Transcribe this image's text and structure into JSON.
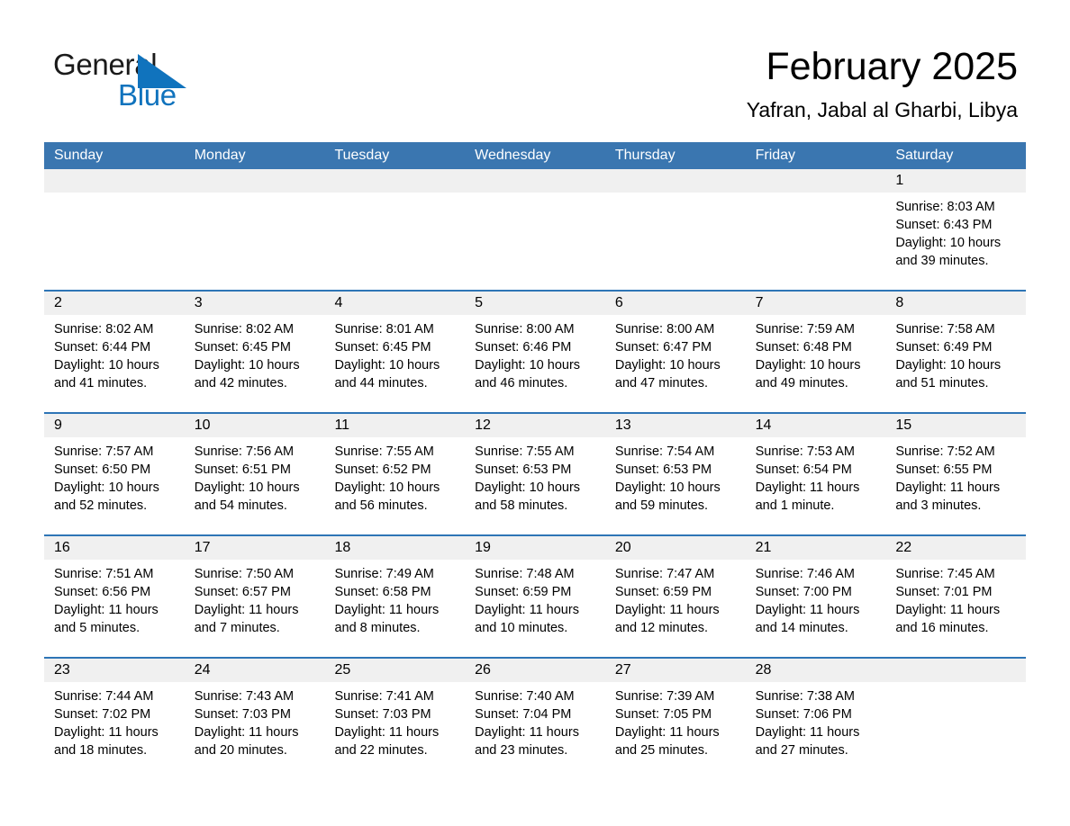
{
  "brand": {
    "name_line1": "General",
    "name_line2": "Blue",
    "accent_color": "#1073bd",
    "triangle_icon": "triangle-icon"
  },
  "header": {
    "title": "February 2025",
    "subtitle": "Yafran, Jabal al Gharbi, Libya"
  },
  "colors": {
    "header_blue": "#3a76b0",
    "row_rule_blue": "#2e75b6",
    "day_strip_gray": "#f0f0f0"
  },
  "weekdays": [
    "Sunday",
    "Monday",
    "Tuesday",
    "Wednesday",
    "Thursday",
    "Friday",
    "Saturday"
  ],
  "weeks": [
    [
      {
        "day": "",
        "empty": true
      },
      {
        "day": "",
        "empty": true
      },
      {
        "day": "",
        "empty": true
      },
      {
        "day": "",
        "empty": true
      },
      {
        "day": "",
        "empty": true
      },
      {
        "day": "",
        "empty": true
      },
      {
        "day": "1",
        "sunrise": "Sunrise: 8:03 AM",
        "sunset": "Sunset: 6:43 PM",
        "daylight_l1": "Daylight: 10 hours",
        "daylight_l2": "and 39 minutes."
      }
    ],
    [
      {
        "day": "2",
        "sunrise": "Sunrise: 8:02 AM",
        "sunset": "Sunset: 6:44 PM",
        "daylight_l1": "Daylight: 10 hours",
        "daylight_l2": "and 41 minutes."
      },
      {
        "day": "3",
        "sunrise": "Sunrise: 8:02 AM",
        "sunset": "Sunset: 6:45 PM",
        "daylight_l1": "Daylight: 10 hours",
        "daylight_l2": "and 42 minutes."
      },
      {
        "day": "4",
        "sunrise": "Sunrise: 8:01 AM",
        "sunset": "Sunset: 6:45 PM",
        "daylight_l1": "Daylight: 10 hours",
        "daylight_l2": "and 44 minutes."
      },
      {
        "day": "5",
        "sunrise": "Sunrise: 8:00 AM",
        "sunset": "Sunset: 6:46 PM",
        "daylight_l1": "Daylight: 10 hours",
        "daylight_l2": "and 46 minutes."
      },
      {
        "day": "6",
        "sunrise": "Sunrise: 8:00 AM",
        "sunset": "Sunset: 6:47 PM",
        "daylight_l1": "Daylight: 10 hours",
        "daylight_l2": "and 47 minutes."
      },
      {
        "day": "7",
        "sunrise": "Sunrise: 7:59 AM",
        "sunset": "Sunset: 6:48 PM",
        "daylight_l1": "Daylight: 10 hours",
        "daylight_l2": "and 49 minutes."
      },
      {
        "day": "8",
        "sunrise": "Sunrise: 7:58 AM",
        "sunset": "Sunset: 6:49 PM",
        "daylight_l1": "Daylight: 10 hours",
        "daylight_l2": "and 51 minutes."
      }
    ],
    [
      {
        "day": "9",
        "sunrise": "Sunrise: 7:57 AM",
        "sunset": "Sunset: 6:50 PM",
        "daylight_l1": "Daylight: 10 hours",
        "daylight_l2": "and 52 minutes."
      },
      {
        "day": "10",
        "sunrise": "Sunrise: 7:56 AM",
        "sunset": "Sunset: 6:51 PM",
        "daylight_l1": "Daylight: 10 hours",
        "daylight_l2": "and 54 minutes."
      },
      {
        "day": "11",
        "sunrise": "Sunrise: 7:55 AM",
        "sunset": "Sunset: 6:52 PM",
        "daylight_l1": "Daylight: 10 hours",
        "daylight_l2": "and 56 minutes."
      },
      {
        "day": "12",
        "sunrise": "Sunrise: 7:55 AM",
        "sunset": "Sunset: 6:53 PM",
        "daylight_l1": "Daylight: 10 hours",
        "daylight_l2": "and 58 minutes."
      },
      {
        "day": "13",
        "sunrise": "Sunrise: 7:54 AM",
        "sunset": "Sunset: 6:53 PM",
        "daylight_l1": "Daylight: 10 hours",
        "daylight_l2": "and 59 minutes."
      },
      {
        "day": "14",
        "sunrise": "Sunrise: 7:53 AM",
        "sunset": "Sunset: 6:54 PM",
        "daylight_l1": "Daylight: 11 hours",
        "daylight_l2": "and 1 minute."
      },
      {
        "day": "15",
        "sunrise": "Sunrise: 7:52 AM",
        "sunset": "Sunset: 6:55 PM",
        "daylight_l1": "Daylight: 11 hours",
        "daylight_l2": "and 3 minutes."
      }
    ],
    [
      {
        "day": "16",
        "sunrise": "Sunrise: 7:51 AM",
        "sunset": "Sunset: 6:56 PM",
        "daylight_l1": "Daylight: 11 hours",
        "daylight_l2": "and 5 minutes."
      },
      {
        "day": "17",
        "sunrise": "Sunrise: 7:50 AM",
        "sunset": "Sunset: 6:57 PM",
        "daylight_l1": "Daylight: 11 hours",
        "daylight_l2": "and 7 minutes."
      },
      {
        "day": "18",
        "sunrise": "Sunrise: 7:49 AM",
        "sunset": "Sunset: 6:58 PM",
        "daylight_l1": "Daylight: 11 hours",
        "daylight_l2": "and 8 minutes."
      },
      {
        "day": "19",
        "sunrise": "Sunrise: 7:48 AM",
        "sunset": "Sunset: 6:59 PM",
        "daylight_l1": "Daylight: 11 hours",
        "daylight_l2": "and 10 minutes."
      },
      {
        "day": "20",
        "sunrise": "Sunrise: 7:47 AM",
        "sunset": "Sunset: 6:59 PM",
        "daylight_l1": "Daylight: 11 hours",
        "daylight_l2": "and 12 minutes."
      },
      {
        "day": "21",
        "sunrise": "Sunrise: 7:46 AM",
        "sunset": "Sunset: 7:00 PM",
        "daylight_l1": "Daylight: 11 hours",
        "daylight_l2": "and 14 minutes."
      },
      {
        "day": "22",
        "sunrise": "Sunrise: 7:45 AM",
        "sunset": "Sunset: 7:01 PM",
        "daylight_l1": "Daylight: 11 hours",
        "daylight_l2": "and 16 minutes."
      }
    ],
    [
      {
        "day": "23",
        "sunrise": "Sunrise: 7:44 AM",
        "sunset": "Sunset: 7:02 PM",
        "daylight_l1": "Daylight: 11 hours",
        "daylight_l2": "and 18 minutes."
      },
      {
        "day": "24",
        "sunrise": "Sunrise: 7:43 AM",
        "sunset": "Sunset: 7:03 PM",
        "daylight_l1": "Daylight: 11 hours",
        "daylight_l2": "and 20 minutes."
      },
      {
        "day": "25",
        "sunrise": "Sunrise: 7:41 AM",
        "sunset": "Sunset: 7:03 PM",
        "daylight_l1": "Daylight: 11 hours",
        "daylight_l2": "and 22 minutes."
      },
      {
        "day": "26",
        "sunrise": "Sunrise: 7:40 AM",
        "sunset": "Sunset: 7:04 PM",
        "daylight_l1": "Daylight: 11 hours",
        "daylight_l2": "and 23 minutes."
      },
      {
        "day": "27",
        "sunrise": "Sunrise: 7:39 AM",
        "sunset": "Sunset: 7:05 PM",
        "daylight_l1": "Daylight: 11 hours",
        "daylight_l2": "and 25 minutes."
      },
      {
        "day": "28",
        "sunrise": "Sunrise: 7:38 AM",
        "sunset": "Sunset: 7:06 PM",
        "daylight_l1": "Daylight: 11 hours",
        "daylight_l2": "and 27 minutes."
      },
      {
        "day": "",
        "empty": true
      }
    ]
  ]
}
